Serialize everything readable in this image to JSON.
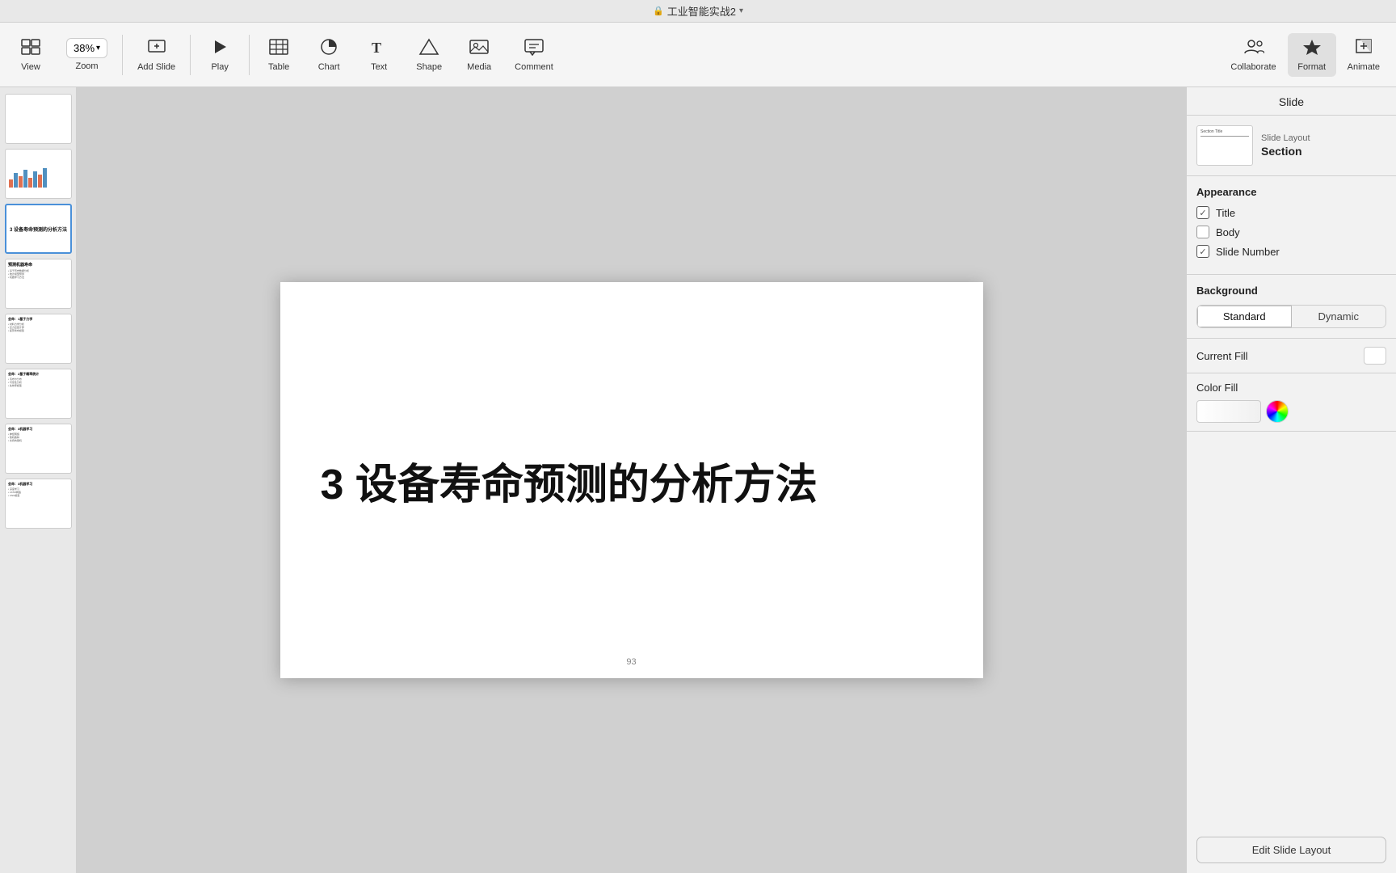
{
  "titleBar": {
    "lockIcon": "🔒",
    "title": "工业智能实战2",
    "chevron": "▾"
  },
  "toolbar": {
    "items": [
      {
        "id": "view",
        "icon": "⊞",
        "label": "View"
      },
      {
        "id": "zoom",
        "value": "38%",
        "label": "Zoom"
      },
      {
        "id": "add-slide",
        "icon": "⊕",
        "label": "Add Slide"
      },
      {
        "id": "play",
        "icon": "▶",
        "label": "Play"
      },
      {
        "id": "table",
        "icon": "⊞",
        "label": "Table"
      },
      {
        "id": "chart",
        "icon": "◑",
        "label": "Chart"
      },
      {
        "id": "text",
        "icon": "T",
        "label": "Text"
      },
      {
        "id": "shape",
        "icon": "◇",
        "label": "Shape"
      },
      {
        "id": "media",
        "icon": "🖼",
        "label": "Media"
      },
      {
        "id": "comment",
        "icon": "💬",
        "label": "Comment"
      },
      {
        "id": "collaborate",
        "icon": "👤",
        "label": "Collaborate"
      },
      {
        "id": "format",
        "icon": "✦",
        "label": "Format"
      },
      {
        "id": "animate",
        "icon": "◈",
        "label": "Animate"
      }
    ]
  },
  "slides": [
    {
      "id": 1,
      "type": "text-only",
      "text": ""
    },
    {
      "id": 2,
      "type": "bar-chart",
      "text": ""
    },
    {
      "id": 3,
      "type": "active",
      "text": "3 设备寿命预测的分析方法"
    },
    {
      "id": 4,
      "type": "text-list",
      "text": "预测机器寿命"
    },
    {
      "id": 5,
      "type": "text-list2",
      "text": "会命：1基于力学"
    },
    {
      "id": 6,
      "type": "text-list3",
      "text": "会命：2基于概率统计的方法"
    },
    {
      "id": 7,
      "type": "text-list4",
      "text": "会命：3机器学习"
    },
    {
      "id": 8,
      "type": "text-list5",
      "text": "会命：3机器学习"
    }
  ],
  "canvas": {
    "mainText": "3 设备寿命预测的分析方法",
    "pageNum": "93"
  },
  "rightPanel": {
    "title": "Slide",
    "layout": {
      "smallLabel": "Slide Layout",
      "name": "Section",
      "previewLabel": "Section Title"
    },
    "appearance": {
      "title": "Appearance",
      "checkboxes": [
        {
          "id": "title",
          "label": "Title",
          "checked": true
        },
        {
          "id": "body",
          "label": "Body",
          "checked": false
        },
        {
          "id": "slideNumber",
          "label": "Slide Number",
          "checked": true
        }
      ]
    },
    "background": {
      "title": "Background",
      "buttons": [
        {
          "id": "standard",
          "label": "Standard",
          "active": true
        },
        {
          "id": "dynamic",
          "label": "Dynamic",
          "active": false
        }
      ]
    },
    "currentFill": {
      "label": "Current Fill"
    },
    "colorFill": {
      "label": "Color Fill"
    },
    "editLayoutBtn": "Edit Slide Layout"
  }
}
